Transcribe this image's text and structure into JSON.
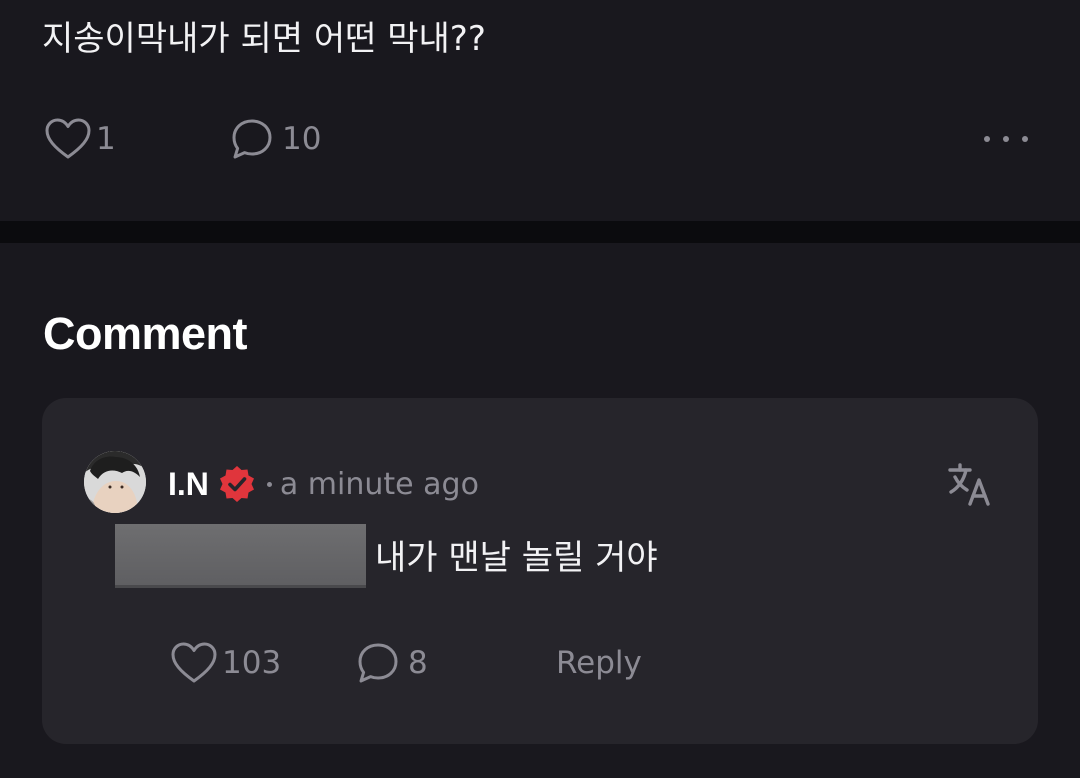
{
  "post": {
    "text": "지송이막내가 되면 어떤 막내??",
    "like_count": "1",
    "comment_count": "10",
    "more_icon": "more-horizontal-icon"
  },
  "comments_section": {
    "title": "Comment"
  },
  "comment": {
    "author": "I.N",
    "verified": true,
    "timestamp": "a minute ago",
    "text": "내가 맨날 놀릴 거야",
    "like_count": "103",
    "reply_count": "8",
    "reply_label": "Reply",
    "translate_icon": "translate-icon"
  },
  "colors": {
    "background": "#19181e",
    "card": "#26252b",
    "muted_text": "#8c8b94",
    "verified_badge": "#e0353c"
  }
}
